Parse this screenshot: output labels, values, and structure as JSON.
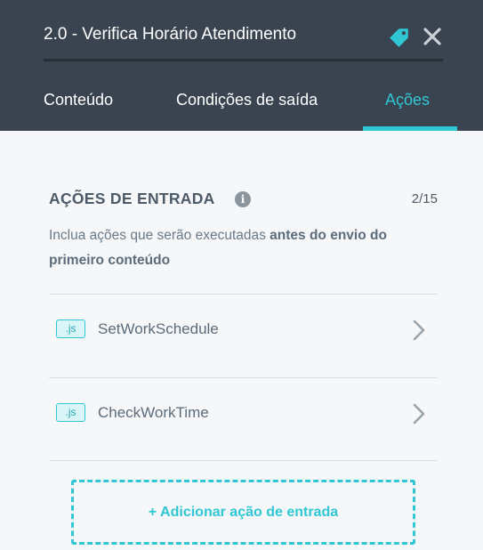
{
  "header": {
    "title_value": "2.0 - Verifica Horário Atendimento",
    "icons": [
      "tag-icon",
      "close-icon"
    ]
  },
  "tabs": [
    {
      "label": "Conteúdo",
      "active": false
    },
    {
      "label": "Condições de saída",
      "active": false
    },
    {
      "label": "Ações",
      "active": true
    }
  ],
  "section": {
    "title": "AÇÕES DE ENTRADA",
    "info_icon": "i",
    "counter": "2/15",
    "description_prefix": "Inclua ações que serão executadas ",
    "description_bold": "antes do envio do primeiro conteúdo"
  },
  "actions": [
    {
      "badge": ".js",
      "label": "SetWorkSchedule"
    },
    {
      "badge": ".js",
      "label": "CheckWorkTime"
    }
  ],
  "add_button_label": "+ Adicionar ação de entrada",
  "colors": {
    "header_bg": "#3a4450",
    "accent": "#2fc7d3",
    "page_bg": "#f5f7f8"
  }
}
